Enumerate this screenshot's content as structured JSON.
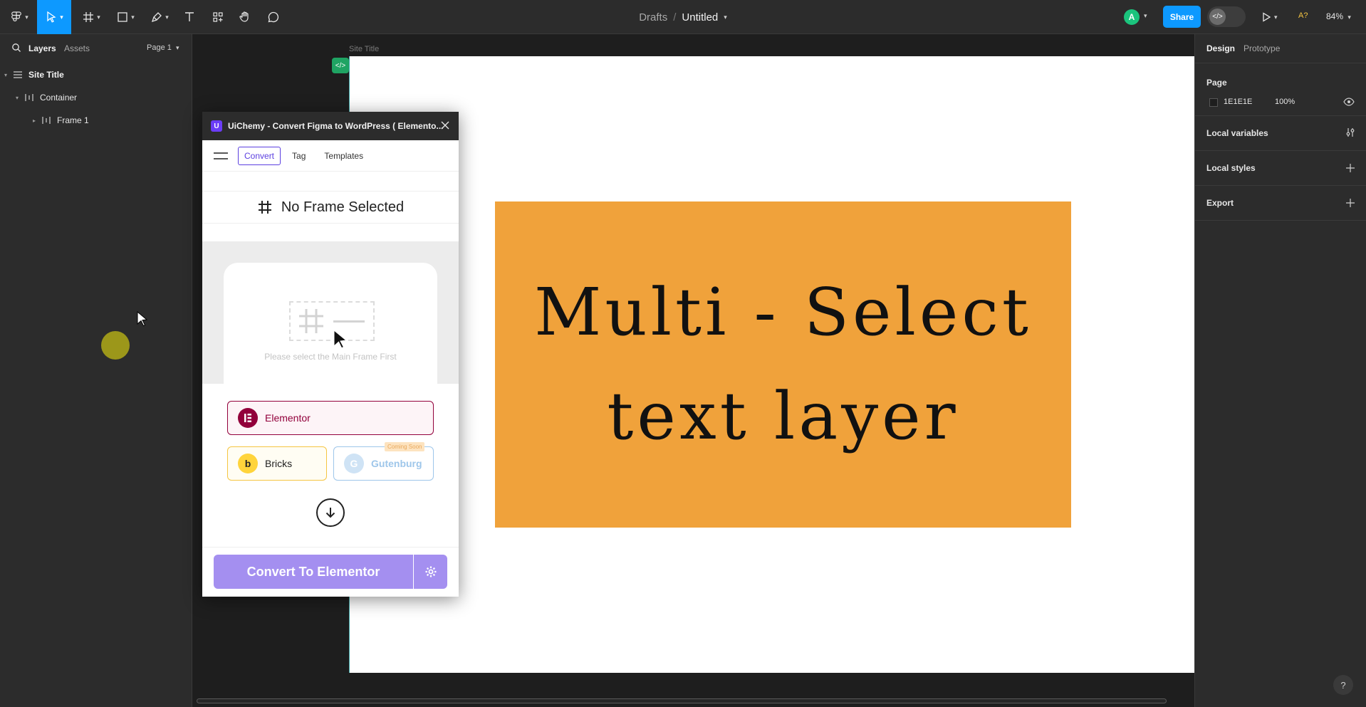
{
  "topbar": {
    "breadcrumb_parent": "Drafts",
    "breadcrumb_sep": "/",
    "file_title": "Untitled",
    "avatar_initial": "A",
    "share_label": "Share",
    "ai_badge": "A?",
    "zoom": "84%"
  },
  "left_panel": {
    "tab_layers": "Layers",
    "tab_assets": "Assets",
    "page_name": "Page 1",
    "layers": [
      {
        "name": "Site Title"
      },
      {
        "name": "Container"
      },
      {
        "name": "Frame 1"
      }
    ]
  },
  "canvas": {
    "frame_label": "Site Title",
    "headline": "Multi - Select text layer",
    "colors": {
      "orange": "#f0a23b",
      "frame_bg": "#ffffff"
    }
  },
  "plugin": {
    "title": "UiChemy - Convert Figma to WordPress ( Elemento...",
    "nav": {
      "convert": "Convert",
      "tag": "Tag",
      "templates": "Templates"
    },
    "no_frame": "No Frame Selected",
    "preview_hint": "Please select the Main Frame First",
    "builders": {
      "elementor": "Elementor",
      "bricks": "Bricks",
      "gutenberg": "Gutenburg",
      "coming_soon": "Coming Soon"
    },
    "convert_button": "Convert To Elementor",
    "accent": "#5b3fe0"
  },
  "right_panel": {
    "tab_design": "Design",
    "tab_prototype": "Prototype",
    "page_heading": "Page",
    "page_color": "1E1E1E",
    "page_opacity": "100%",
    "local_variables": "Local variables",
    "local_styles": "Local styles",
    "export": "Export",
    "help": "?"
  }
}
